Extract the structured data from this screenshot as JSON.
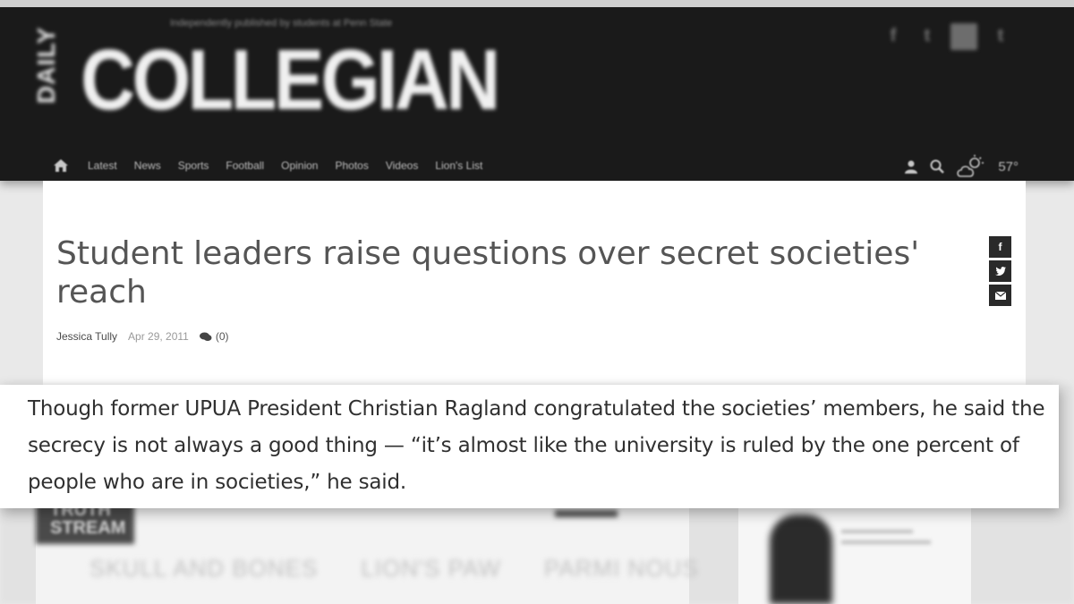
{
  "masthead": {
    "tagline": "Independently published by students at Penn State",
    "logo_small": "DAILY",
    "logo_main": "COLLEGIAN",
    "social_top": [
      "f",
      "t",
      "",
      "t"
    ]
  },
  "nav": {
    "home_icon": "home-icon",
    "items": [
      "Latest",
      "News",
      "Sports",
      "Football",
      "Opinion",
      "Photos",
      "Videos",
      "Lion's List"
    ],
    "user_icon": "user-icon",
    "search_icon": "search-icon",
    "weather_icon": "partly-cloudy-icon",
    "temperature": "57°"
  },
  "article": {
    "headline": "Student leaders raise questions over secret societies' reach",
    "author": "Jessica Tully",
    "date": "Apr 29, 2011",
    "comments": "(0)",
    "share": {
      "facebook": "f",
      "twitter": "twitter-icon",
      "email": "email-icon"
    }
  },
  "quote": {
    "text": "Though former UPUA President Christian Ragland congratulated the societies’ members, he said the secrecy is not always a good thing — “it’s almost like the university is ruled by the one percent of people who are in societies,” he said."
  },
  "background": {
    "stream_text": [
      "TRUTH",
      "STREAM"
    ],
    "tabs": [
      "SKULL AND BONES",
      "LION'S PAW",
      "PARMI NOUS"
    ]
  },
  "colors": {
    "masthead_bg": "#1a1a1a",
    "headline": "#555555",
    "quote_text": "#303030"
  }
}
